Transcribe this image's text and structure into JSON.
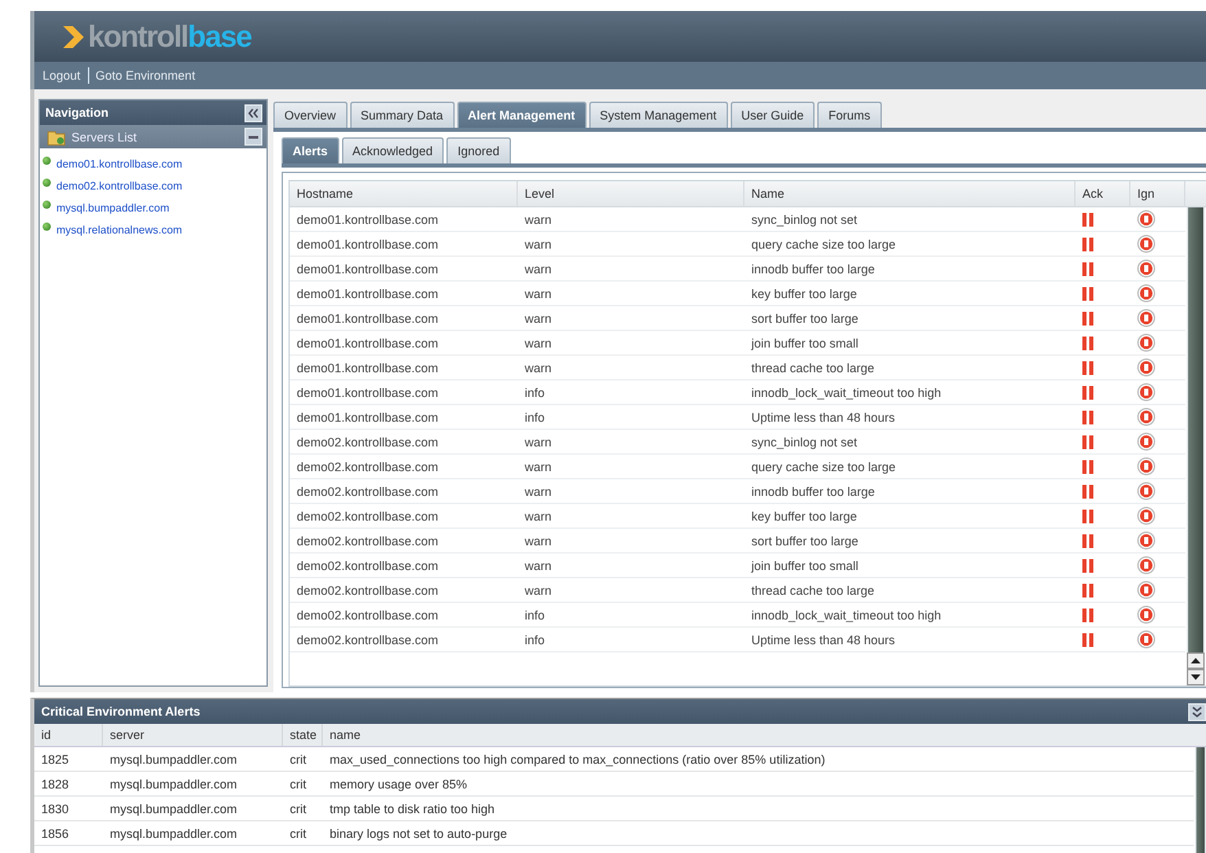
{
  "header": {
    "logo": {
      "part1": "kontroll",
      "part2": "base"
    }
  },
  "top_links": [
    "Logout",
    "Goto Environment"
  ],
  "navigation": {
    "title": "Navigation",
    "servers_list": {
      "title": "Servers List",
      "items": [
        "demo01.kontrollbase.com",
        "demo02.kontrollbase.com",
        "mysql.bumpaddler.com",
        "mysql.relationalnews.com"
      ]
    }
  },
  "tabs": [
    {
      "label": "Overview",
      "selected": false
    },
    {
      "label": "Summary Data",
      "selected": false
    },
    {
      "label": "Alert Management",
      "selected": true
    },
    {
      "label": "System Management",
      "selected": false
    },
    {
      "label": "User Guide",
      "selected": false
    },
    {
      "label": "Forums",
      "selected": false
    }
  ],
  "subtabs": [
    {
      "label": "Alerts",
      "selected": true
    },
    {
      "label": "Acknowledged",
      "selected": false
    },
    {
      "label": "Ignored",
      "selected": false
    }
  ],
  "alerts_table": {
    "columns": [
      "Hostname",
      "Level",
      "Name",
      "Ack",
      "Ign"
    ],
    "rows": [
      {
        "hostname": "demo01.kontrollbase.com",
        "level": "warn",
        "name": "sync_binlog not set"
      },
      {
        "hostname": "demo01.kontrollbase.com",
        "level": "warn",
        "name": "query cache size too large"
      },
      {
        "hostname": "demo01.kontrollbase.com",
        "level": "warn",
        "name": "innodb buffer too large"
      },
      {
        "hostname": "demo01.kontrollbase.com",
        "level": "warn",
        "name": "key buffer too large"
      },
      {
        "hostname": "demo01.kontrollbase.com",
        "level": "warn",
        "name": "sort buffer too large"
      },
      {
        "hostname": "demo01.kontrollbase.com",
        "level": "warn",
        "name": "join buffer too small"
      },
      {
        "hostname": "demo01.kontrollbase.com",
        "level": "warn",
        "name": "thread cache too large"
      },
      {
        "hostname": "demo01.kontrollbase.com",
        "level": "info",
        "name": "innodb_lock_wait_timeout too high"
      },
      {
        "hostname": "demo01.kontrollbase.com",
        "level": "info",
        "name": "Uptime less than 48 hours"
      },
      {
        "hostname": "demo02.kontrollbase.com",
        "level": "warn",
        "name": "sync_binlog not set"
      },
      {
        "hostname": "demo02.kontrollbase.com",
        "level": "warn",
        "name": "query cache size too large"
      },
      {
        "hostname": "demo02.kontrollbase.com",
        "level": "warn",
        "name": "innodb buffer too large"
      },
      {
        "hostname": "demo02.kontrollbase.com",
        "level": "warn",
        "name": "key buffer too large"
      },
      {
        "hostname": "demo02.kontrollbase.com",
        "level": "warn",
        "name": "sort buffer too large"
      },
      {
        "hostname": "demo02.kontrollbase.com",
        "level": "warn",
        "name": "join buffer too small"
      },
      {
        "hostname": "demo02.kontrollbase.com",
        "level": "warn",
        "name": "thread cache too large"
      },
      {
        "hostname": "demo02.kontrollbase.com",
        "level": "info",
        "name": "innodb_lock_wait_timeout too high"
      },
      {
        "hostname": "demo02.kontrollbase.com",
        "level": "info",
        "name": "Uptime less than 48 hours"
      }
    ]
  },
  "critical_alerts": {
    "title": "Critical Environment Alerts",
    "columns": [
      "id",
      "server",
      "state",
      "name"
    ],
    "rows": [
      {
        "id": "1825",
        "server": "mysql.bumpaddler.com",
        "state": "crit",
        "name": "max_used_connections too high compared to max_connections (ratio over 85% utilization)"
      },
      {
        "id": "1828",
        "server": "mysql.bumpaddler.com",
        "state": "crit",
        "name": "memory usage over 85%"
      },
      {
        "id": "1830",
        "server": "mysql.bumpaddler.com",
        "state": "crit",
        "name": "tmp table to disk ratio too high"
      },
      {
        "id": "1856",
        "server": "mysql.bumpaddler.com",
        "state": "crit",
        "name": "binary logs not set to auto-purge"
      }
    ]
  }
}
